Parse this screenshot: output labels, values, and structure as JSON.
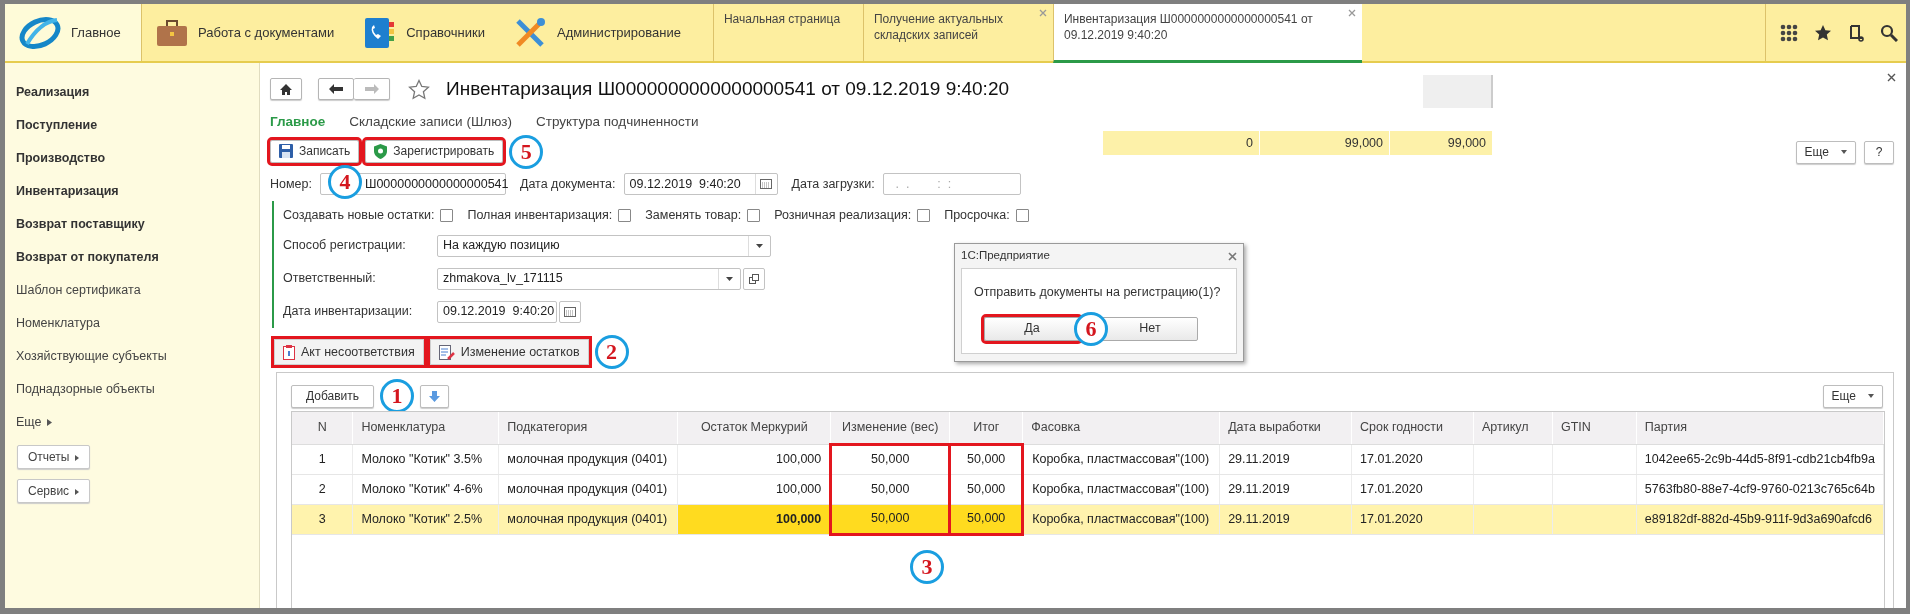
{
  "top_sections": [
    {
      "label": "Главное",
      "kind": "logo",
      "selected": true
    },
    {
      "label": "Работа с документами",
      "kind": "briefcase",
      "selected": false
    },
    {
      "label": "Справочники",
      "kind": "book",
      "selected": false
    },
    {
      "label": "Администрирование",
      "kind": "tools",
      "selected": false
    }
  ],
  "open_tabs": [
    {
      "label": "Начальная страница",
      "selected": false,
      "closable": false
    },
    {
      "label": "Получение актуальных складских записей",
      "selected": false,
      "closable": true
    },
    {
      "label": "Инвентаризация Ш0000000000000000541 от 09.12.2019 9:40:20",
      "selected": true,
      "closable": true
    }
  ],
  "sidebar": {
    "items": [
      {
        "label": "Реализация",
        "kind": "section"
      },
      {
        "label": "Поступление",
        "kind": "section"
      },
      {
        "label": "Производство",
        "kind": "section"
      },
      {
        "label": "Инвентаризация",
        "kind": "section"
      },
      {
        "label": "Возврат поставщику",
        "kind": "section"
      },
      {
        "label": "Возврат от покупателя",
        "kind": "section"
      },
      {
        "label": "Шаблон сертификата",
        "kind": "link"
      },
      {
        "label": "Номенклатура",
        "kind": "link"
      },
      {
        "label": "Хозяйствующие субъекты",
        "kind": "link"
      },
      {
        "label": "Поднадзорные объекты",
        "kind": "link"
      },
      {
        "label": "Еще",
        "kind": "more"
      }
    ],
    "buttons": [
      "Отчеты",
      "Сервис"
    ]
  },
  "form": {
    "title": "Инвентаризация Ш0000000000000000541 от 09.12.2019 9:40:20",
    "tabs": [
      {
        "label": "Главное",
        "selected": true
      },
      {
        "label": "Складские записи (Шлюз)",
        "selected": false
      },
      {
        "label": "Структура подчиненности",
        "selected": false
      }
    ],
    "commands": [
      {
        "label": "Записать",
        "kind": "save",
        "highlighted": true,
        "callout": "4"
      },
      {
        "label": "Зарегистрировать",
        "kind": "register",
        "highlighted": true,
        "callout": "5"
      }
    ],
    "more_button": "Еще",
    "help_button": "?",
    "summary": [
      "0",
      "99,000",
      "99,000"
    ],
    "header_fields": [
      {
        "label": "Номер:",
        "value": "Ш0000000000000000541",
        "kind": "text"
      },
      {
        "label": "Дата документа:",
        "value": "09.12.2019  9:40:20",
        "kind": "date"
      },
      {
        "label": "Дата загрузки:",
        "placeholder": "  .  .        :  :",
        "kind": "plain"
      }
    ],
    "checkboxes": [
      {
        "label": "Создавать новые остатки:",
        "checked": false
      },
      {
        "label": "Полная инвентаризация:",
        "checked": false
      },
      {
        "label": "Заменять товар:",
        "checked": false
      },
      {
        "label": "Розничная реализация:",
        "checked": false
      },
      {
        "label": "Просрочка:",
        "checked": false
      }
    ],
    "fields": [
      {
        "label": "Способ регистрации:",
        "value": "На каждую позицию",
        "kind": "select"
      },
      {
        "label": "Ответственный:",
        "value": "zhmakova_lv_171115",
        "kind": "reference"
      },
      {
        "label": "Дата инвентаризации:",
        "value": "09.12.2019  9:40:20",
        "kind": "date"
      }
    ],
    "pages": [
      {
        "label": "Акт несоответствия",
        "kind": "clipboard",
        "highlighted": true
      },
      {
        "label": "Изменение остатков",
        "kind": "edit",
        "highlighted": true,
        "callout": "2"
      }
    ],
    "add_button": {
      "label": "Добавить",
      "callout": "1"
    },
    "table_more_button": "Еще",
    "table": {
      "callout": "3",
      "columns": [
        {
          "label": "N",
          "kind": "index",
          "highlighted": false,
          "editable": false
        },
        {
          "label": "Номенклатура",
          "kind": "text",
          "highlighted": false,
          "editable": false
        },
        {
          "label": "Подкатегория",
          "kind": "text",
          "highlighted": false,
          "editable": false
        },
        {
          "label": "Остаток Меркурий",
          "kind": "number",
          "highlighted": false,
          "editable": true
        },
        {
          "label": "Изменение (вес)",
          "kind": "measure",
          "highlighted": true,
          "editable": true
        },
        {
          "label": "Итог",
          "kind": "measure",
          "highlighted": true,
          "editable": true
        },
        {
          "label": "Фасовка",
          "kind": "text",
          "highlighted": false,
          "editable": false
        },
        {
          "label": "Дата выработки",
          "kind": "text",
          "highlighted": false,
          "editable": false
        },
        {
          "label": "Срок годности",
          "kind": "text",
          "highlighted": false,
          "editable": false
        },
        {
          "label": "Артикул",
          "kind": "text",
          "highlighted": false,
          "editable": false
        },
        {
          "label": "GTIN",
          "kind": "text",
          "highlighted": false,
          "editable": false
        },
        {
          "label": "Партия",
          "kind": "text",
          "highlighted": false,
          "editable": false
        }
      ],
      "rows": [
        {
          "selected": false,
          "cells": [
            "1",
            "Молоко \"Котик\" 3.5%",
            "молочная продукция (0401)",
            "100,000",
            "50,000",
            "50,000",
            "Коробка, пластмассовая\"(100)",
            "29.11.2019",
            "17.01.2020",
            null,
            null,
            "1042ee65-2c9b-44d5-8f91-cdb21cb4fb9a"
          ]
        },
        {
          "selected": false,
          "cells": [
            "2",
            "Молоко \"Котик\" 4-6%",
            "молочная продукция (0401)",
            "100,000",
            "50,000",
            "50,000",
            "Коробка, пластмассовая\"(100)",
            "29.11.2019",
            "17.01.2020",
            null,
            null,
            "5763fb80-88e7-4cf9-9760-0213c765c64b"
          ]
        },
        {
          "selected": true,
          "cells": [
            "3",
            "Молоко \"Котик\" 2.5%",
            "молочная продукция (0401)",
            "100,000",
            "50,000",
            "50,000",
            "Коробка, пластмассовая\"(100)",
            "29.11.2019",
            "17.01.2020",
            null,
            null,
            "e89182df-882d-45b9-911f-9d3a690afcd6"
          ]
        }
      ]
    },
    "dialog": {
      "title": "1С:Предприятие",
      "message": "Отправить документы на регистрацию(1)?",
      "buttons": [
        {
          "label": "Да",
          "highlighted": true,
          "callout": "6"
        },
        {
          "label": "Нет",
          "highlighted": false
        }
      ]
    }
  }
}
